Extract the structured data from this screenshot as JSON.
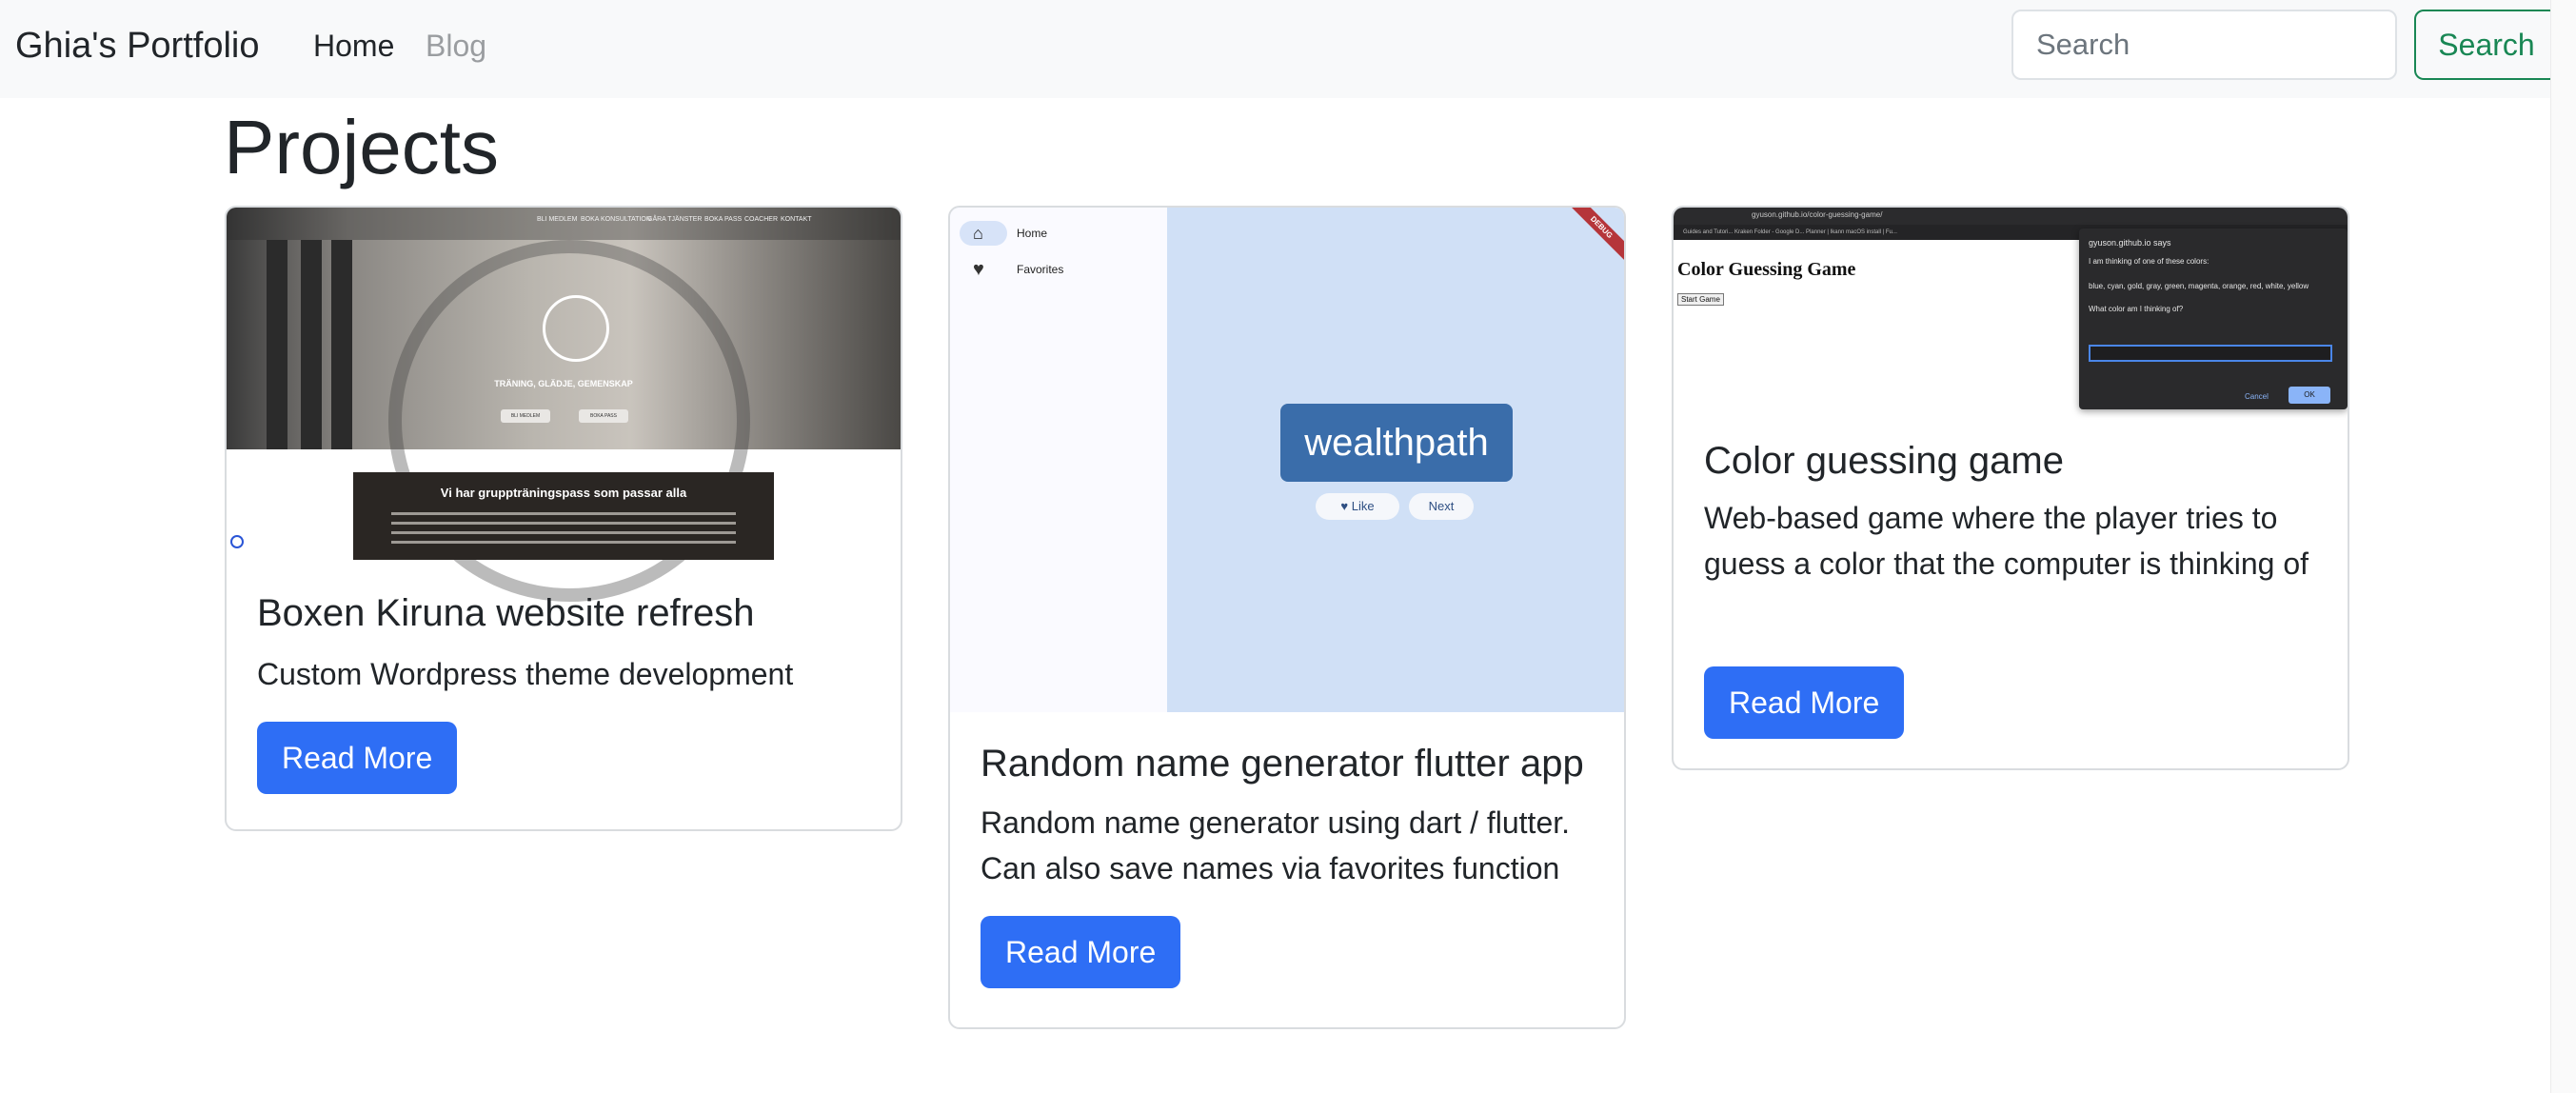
{
  "navbar": {
    "brand": "Ghia's Portfolio",
    "links": [
      "Home",
      "Blog"
    ],
    "search_placeholder": "Search",
    "search_button": "Search"
  },
  "page": {
    "title": "Projects"
  },
  "cards": [
    {
      "title": "Boxen Kiruna website refresh",
      "text": "Custom Wordpress theme development",
      "button": "Read More",
      "image": {
        "nav_items": [
          "BLI MEDLEM",
          "BOKA KONSULTATION",
          "GÅRA TJÄNSTER",
          "BOKA PASS",
          "COACHER",
          "KONTAKT"
        ],
        "tagline": "TRÄNING, GLÄDJE, GEMENSKAP",
        "buttons": [
          "BLI MEDLEM",
          "BOKA PASS"
        ],
        "box_heading": "Vi har gruppträningspass som passar alla"
      }
    },
    {
      "title": "Random name generator flutter app",
      "text": "Random name generator using dart / flutter. Can also save names via favorites function",
      "button": "Read More",
      "image": {
        "rail_items": [
          "Home",
          "Favorites"
        ],
        "word": "wealthpath",
        "like": "Like",
        "next": "Next",
        "banner": "DEBUG"
      }
    },
    {
      "title": "Color guessing game",
      "text": "Web-based game where the player tries to guess a color that the computer is thinking of",
      "button": "Read More",
      "image": {
        "url": "gyuson.github.io/color-guessing-game/",
        "bookmarks": "Guides and Tutori...   Kraken   Folder - Google D...   Planner | Ikann   macOS install | Fu...",
        "heading": "Color Guessing Game",
        "start_button": "Start Game",
        "dialog_title": "gyuson.github.io says",
        "dialog_line1": "I am thinking of one of these colors:",
        "dialog_line2": "blue, cyan, gold, gray, green, magenta, orange, red, white, yellow",
        "dialog_line3": "What color am I thinking of?",
        "cancel": "Cancel",
        "ok": "OK"
      }
    }
  ],
  "colors": {
    "primary": "#2e6ef5",
    "success": "#198754",
    "navbar_bg": "#f8f9fa",
    "muted": "#9a9da0"
  }
}
